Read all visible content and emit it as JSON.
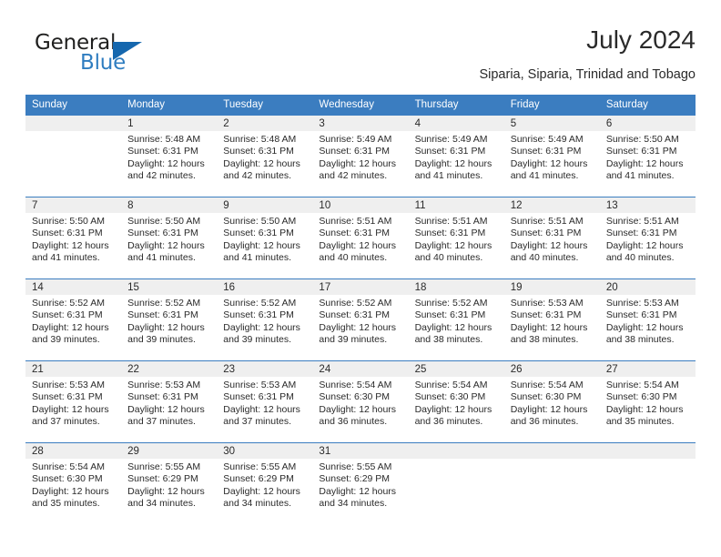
{
  "brand": {
    "word_one": "General",
    "word_two": "Blue",
    "triangle_icon": "triangle-icon",
    "accent_color": "#2f7dc0",
    "triangle_color": "#1567ae"
  },
  "header": {
    "title": "July 2024",
    "subtitle": "Siparia, Siparia, Trinidad and Tobago"
  },
  "calendar": {
    "header_bg": "#3b7dc0",
    "header_text_color": "#ffffff",
    "datenum_band_bg": "#efefef",
    "weekdays": [
      "Sunday",
      "Monday",
      "Tuesday",
      "Wednesday",
      "Thursday",
      "Friday",
      "Saturday"
    ],
    "weeks": [
      [
        {
          "day": "",
          "lines": []
        },
        {
          "day": "1",
          "lines": [
            "Sunrise: 5:48 AM",
            "Sunset: 6:31 PM",
            "Daylight: 12 hours",
            "and 42 minutes."
          ]
        },
        {
          "day": "2",
          "lines": [
            "Sunrise: 5:48 AM",
            "Sunset: 6:31 PM",
            "Daylight: 12 hours",
            "and 42 minutes."
          ]
        },
        {
          "day": "3",
          "lines": [
            "Sunrise: 5:49 AM",
            "Sunset: 6:31 PM",
            "Daylight: 12 hours",
            "and 42 minutes."
          ]
        },
        {
          "day": "4",
          "lines": [
            "Sunrise: 5:49 AM",
            "Sunset: 6:31 PM",
            "Daylight: 12 hours",
            "and 41 minutes."
          ]
        },
        {
          "day": "5",
          "lines": [
            "Sunrise: 5:49 AM",
            "Sunset: 6:31 PM",
            "Daylight: 12 hours",
            "and 41 minutes."
          ]
        },
        {
          "day": "6",
          "lines": [
            "Sunrise: 5:50 AM",
            "Sunset: 6:31 PM",
            "Daylight: 12 hours",
            "and 41 minutes."
          ]
        }
      ],
      [
        {
          "day": "7",
          "lines": [
            "Sunrise: 5:50 AM",
            "Sunset: 6:31 PM",
            "Daylight: 12 hours",
            "and 41 minutes."
          ]
        },
        {
          "day": "8",
          "lines": [
            "Sunrise: 5:50 AM",
            "Sunset: 6:31 PM",
            "Daylight: 12 hours",
            "and 41 minutes."
          ]
        },
        {
          "day": "9",
          "lines": [
            "Sunrise: 5:50 AM",
            "Sunset: 6:31 PM",
            "Daylight: 12 hours",
            "and 41 minutes."
          ]
        },
        {
          "day": "10",
          "lines": [
            "Sunrise: 5:51 AM",
            "Sunset: 6:31 PM",
            "Daylight: 12 hours",
            "and 40 minutes."
          ]
        },
        {
          "day": "11",
          "lines": [
            "Sunrise: 5:51 AM",
            "Sunset: 6:31 PM",
            "Daylight: 12 hours",
            "and 40 minutes."
          ]
        },
        {
          "day": "12",
          "lines": [
            "Sunrise: 5:51 AM",
            "Sunset: 6:31 PM",
            "Daylight: 12 hours",
            "and 40 minutes."
          ]
        },
        {
          "day": "13",
          "lines": [
            "Sunrise: 5:51 AM",
            "Sunset: 6:31 PM",
            "Daylight: 12 hours",
            "and 40 minutes."
          ]
        }
      ],
      [
        {
          "day": "14",
          "lines": [
            "Sunrise: 5:52 AM",
            "Sunset: 6:31 PM",
            "Daylight: 12 hours",
            "and 39 minutes."
          ]
        },
        {
          "day": "15",
          "lines": [
            "Sunrise: 5:52 AM",
            "Sunset: 6:31 PM",
            "Daylight: 12 hours",
            "and 39 minutes."
          ]
        },
        {
          "day": "16",
          "lines": [
            "Sunrise: 5:52 AM",
            "Sunset: 6:31 PM",
            "Daylight: 12 hours",
            "and 39 minutes."
          ]
        },
        {
          "day": "17",
          "lines": [
            "Sunrise: 5:52 AM",
            "Sunset: 6:31 PM",
            "Daylight: 12 hours",
            "and 39 minutes."
          ]
        },
        {
          "day": "18",
          "lines": [
            "Sunrise: 5:52 AM",
            "Sunset: 6:31 PM",
            "Daylight: 12 hours",
            "and 38 minutes."
          ]
        },
        {
          "day": "19",
          "lines": [
            "Sunrise: 5:53 AM",
            "Sunset: 6:31 PM",
            "Daylight: 12 hours",
            "and 38 minutes."
          ]
        },
        {
          "day": "20",
          "lines": [
            "Sunrise: 5:53 AM",
            "Sunset: 6:31 PM",
            "Daylight: 12 hours",
            "and 38 minutes."
          ]
        }
      ],
      [
        {
          "day": "21",
          "lines": [
            "Sunrise: 5:53 AM",
            "Sunset: 6:31 PM",
            "Daylight: 12 hours",
            "and 37 minutes."
          ]
        },
        {
          "day": "22",
          "lines": [
            "Sunrise: 5:53 AM",
            "Sunset: 6:31 PM",
            "Daylight: 12 hours",
            "and 37 minutes."
          ]
        },
        {
          "day": "23",
          "lines": [
            "Sunrise: 5:53 AM",
            "Sunset: 6:31 PM",
            "Daylight: 12 hours",
            "and 37 minutes."
          ]
        },
        {
          "day": "24",
          "lines": [
            "Sunrise: 5:54 AM",
            "Sunset: 6:30 PM",
            "Daylight: 12 hours",
            "and 36 minutes."
          ]
        },
        {
          "day": "25",
          "lines": [
            "Sunrise: 5:54 AM",
            "Sunset: 6:30 PM",
            "Daylight: 12 hours",
            "and 36 minutes."
          ]
        },
        {
          "day": "26",
          "lines": [
            "Sunrise: 5:54 AM",
            "Sunset: 6:30 PM",
            "Daylight: 12 hours",
            "and 36 minutes."
          ]
        },
        {
          "day": "27",
          "lines": [
            "Sunrise: 5:54 AM",
            "Sunset: 6:30 PM",
            "Daylight: 12 hours",
            "and 35 minutes."
          ]
        }
      ],
      [
        {
          "day": "28",
          "lines": [
            "Sunrise: 5:54 AM",
            "Sunset: 6:30 PM",
            "Daylight: 12 hours",
            "and 35 minutes."
          ]
        },
        {
          "day": "29",
          "lines": [
            "Sunrise: 5:55 AM",
            "Sunset: 6:29 PM",
            "Daylight: 12 hours",
            "and 34 minutes."
          ]
        },
        {
          "day": "30",
          "lines": [
            "Sunrise: 5:55 AM",
            "Sunset: 6:29 PM",
            "Daylight: 12 hours",
            "and 34 minutes."
          ]
        },
        {
          "day": "31",
          "lines": [
            "Sunrise: 5:55 AM",
            "Sunset: 6:29 PM",
            "Daylight: 12 hours",
            "and 34 minutes."
          ]
        },
        {
          "day": "",
          "lines": []
        },
        {
          "day": "",
          "lines": []
        },
        {
          "day": "",
          "lines": []
        }
      ]
    ]
  }
}
